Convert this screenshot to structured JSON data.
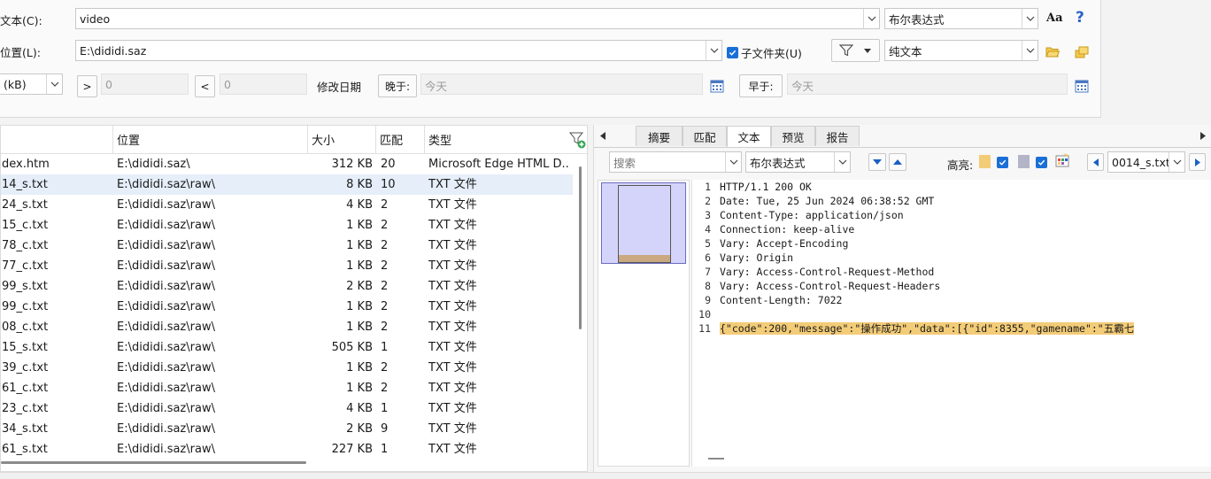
{
  "search": {
    "text_label": "文本(C):",
    "text_value": "video",
    "mode": "布尔表达式",
    "case_icon_label": "Aa",
    "help_label": "?",
    "location_label": "位置(L):",
    "location_value": "E:\\dididi.saz",
    "subfolders_label": "子文件夹(U)",
    "content_type": "纯文本",
    "size_unit": "(kB)",
    "gt_label": ">",
    "gt_value": "0",
    "lt_label": "<",
    "lt_value": "0",
    "date_label": "修改日期",
    "after_label": "晚于:",
    "after_value": "今天",
    "before_label": "早于:",
    "before_value": "今天"
  },
  "results": {
    "columns": [
      "位置",
      "大小",
      "匹配",
      "类型"
    ],
    "rows": [
      {
        "name": "dex.htm",
        "location": "E:\\dididi.saz\\",
        "size": "312 KB",
        "matches": "20",
        "type": "Microsoft Edge HTML D..."
      },
      {
        "name": "14_s.txt",
        "location": "E:\\dididi.saz\\raw\\",
        "size": "8 KB",
        "matches": "10",
        "type": "TXT 文件"
      },
      {
        "name": "24_s.txt",
        "location": "E:\\dididi.saz\\raw\\",
        "size": "4 KB",
        "matches": "2",
        "type": "TXT 文件"
      },
      {
        "name": "15_c.txt",
        "location": "E:\\dididi.saz\\raw\\",
        "size": "1 KB",
        "matches": "2",
        "type": "TXT 文件"
      },
      {
        "name": "78_c.txt",
        "location": "E:\\dididi.saz\\raw\\",
        "size": "1 KB",
        "matches": "2",
        "type": "TXT 文件"
      },
      {
        "name": "77_c.txt",
        "location": "E:\\dididi.saz\\raw\\",
        "size": "1 KB",
        "matches": "2",
        "type": "TXT 文件"
      },
      {
        "name": "99_s.txt",
        "location": "E:\\dididi.saz\\raw\\",
        "size": "2 KB",
        "matches": "2",
        "type": "TXT 文件"
      },
      {
        "name": "99_c.txt",
        "location": "E:\\dididi.saz\\raw\\",
        "size": "1 KB",
        "matches": "2",
        "type": "TXT 文件"
      },
      {
        "name": "08_c.txt",
        "location": "E:\\dididi.saz\\raw\\",
        "size": "1 KB",
        "matches": "2",
        "type": "TXT 文件"
      },
      {
        "name": "15_s.txt",
        "location": "E:\\dididi.saz\\raw\\",
        "size": "505 KB",
        "matches": "1",
        "type": "TXT 文件"
      },
      {
        "name": "39_c.txt",
        "location": "E:\\dididi.saz\\raw\\",
        "size": "1 KB",
        "matches": "2",
        "type": "TXT 文件"
      },
      {
        "name": "61_c.txt",
        "location": "E:\\dididi.saz\\raw\\",
        "size": "1 KB",
        "matches": "2",
        "type": "TXT 文件"
      },
      {
        "name": "23_c.txt",
        "location": "E:\\dididi.saz\\raw\\",
        "size": "4 KB",
        "matches": "1",
        "type": "TXT 文件"
      },
      {
        "name": "34_s.txt",
        "location": "E:\\dididi.saz\\raw\\",
        "size": "2 KB",
        "matches": "9",
        "type": "TXT 文件"
      },
      {
        "name": "61_s.txt",
        "location": "E:\\dididi.saz\\raw\\",
        "size": "227 KB",
        "matches": "1",
        "type": "TXT 文件"
      }
    ]
  },
  "preview": {
    "tabs": [
      "摘要",
      "匹配",
      "文本",
      "预览",
      "报告"
    ],
    "active_tab": "文本",
    "find_placeholder": "搜索",
    "find_mode": "布尔表达式",
    "highlight_label": "高亮:",
    "file_select": "0014_s.txt",
    "lines": [
      {
        "n": "1",
        "text": "HTTP/1.1 200 OK"
      },
      {
        "n": "2",
        "text": "Date: Tue, 25 Jun 2024 06:38:52 GMT"
      },
      {
        "n": "3",
        "text": "Content-Type: application/json"
      },
      {
        "n": "4",
        "text": "Connection: keep-alive"
      },
      {
        "n": "5",
        "text": "Vary: Accept-Encoding"
      },
      {
        "n": "6",
        "text": "Vary: Origin"
      },
      {
        "n": "7",
        "text": "Vary: Access-Control-Request-Method"
      },
      {
        "n": "8",
        "text": "Vary: Access-Control-Request-Headers"
      },
      {
        "n": "9",
        "text": "Content-Length: 7022"
      },
      {
        "n": "10",
        "text": ""
      },
      {
        "n": "11",
        "text": "{\"code\":200,\"message\":\"操作成功\",\"data\":[{\"id\":8355,\"gamename\":\"五霸七"
      }
    ]
  },
  "colors": {
    "accent": "#1a6fd6",
    "selection": "#e5eef9",
    "highlight": "#f3cc78",
    "thumb_fill": "#d4d4fb"
  }
}
